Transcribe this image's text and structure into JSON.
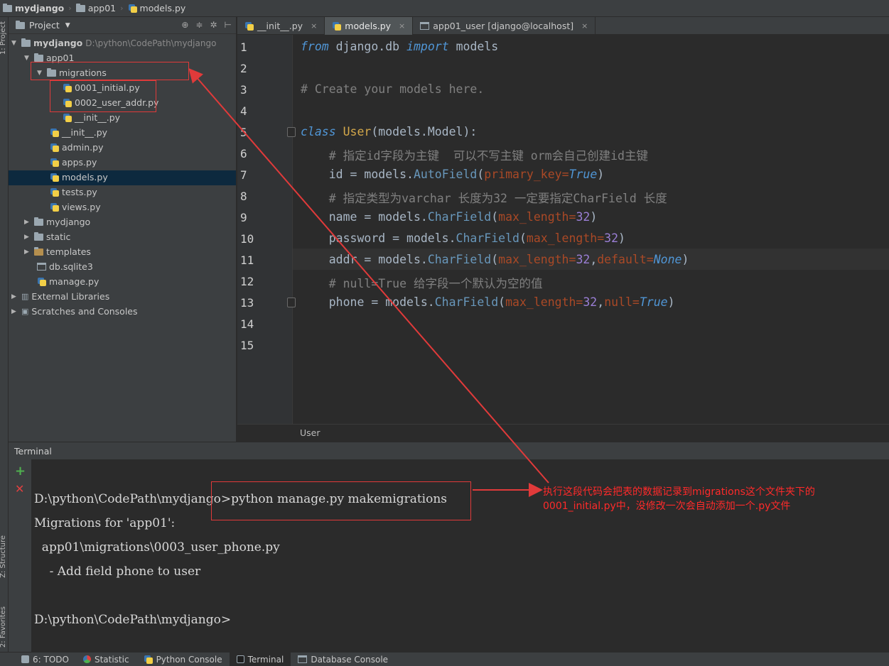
{
  "breadcrumb": [
    "mydjango",
    "app01",
    "models.py"
  ],
  "left_strip": {
    "project_tab": "1: Project",
    "structure_tab": "Z: Structure",
    "favorites_tab": "2: Favorites"
  },
  "project": {
    "header": "Project",
    "root_name": "mydjango",
    "root_path": "D:\\python\\CodePath\\mydjango",
    "items": {
      "app01": "app01",
      "migrations": "migrations",
      "m1": "0001_initial.py",
      "m2": "0002_user_addr.py",
      "m_init": "__init__.py",
      "init": "__init__.py",
      "admin": "admin.py",
      "apps": "apps.py",
      "models": "models.py",
      "tests": "tests.py",
      "views": "views.py",
      "mydjango": "mydjango",
      "static": "static",
      "templates": "templates",
      "db": "db.sqlite3",
      "manage": "manage.py",
      "ext": "External Libraries",
      "scratch": "Scratches and Consoles"
    }
  },
  "tabs": [
    {
      "label": "__init__.py"
    },
    {
      "label": "models.py"
    },
    {
      "label": "app01_user [django@localhost]"
    }
  ],
  "editor": {
    "line_numbers": [
      "1",
      "2",
      "3",
      "4",
      "5",
      "6",
      "7",
      "8",
      "9",
      "10",
      "11",
      "12",
      "13",
      "14",
      "15"
    ],
    "line1": {
      "from": "from",
      "mod": " django.db ",
      "import": "import",
      "rest": " models"
    },
    "line3": "# Create your models here.",
    "line5": {
      "class": "class",
      "name": " User",
      "rest": "(models.Model):"
    },
    "line6": "    # 指定id字段为主键  可以不写主键 orm会自己创建id主键",
    "line7": {
      "a": "    id = models.",
      "fn": "AutoField",
      "b": "(",
      "p": "primary_key=",
      "v": "True",
      "c": ")"
    },
    "line8": "    # 指定类型为varchar 长度为32 一定要指定CharField 长度",
    "line9": {
      "a": "    name = models.",
      "fn": "CharField",
      "b": "(",
      "p": "max_length=",
      "n": "32",
      "c": ")"
    },
    "line10": {
      "a": "    password = models.",
      "fn": "CharField",
      "b": "(",
      "p": "max_length=",
      "n": "32",
      "c": ")"
    },
    "line11": {
      "a": "    addr = models.",
      "fn": "CharField",
      "b": "(",
      "p": "max_length=",
      "n": "32",
      "d": ",",
      "p2": "default=",
      "v": "None",
      "c": ")"
    },
    "line12": "    # null=True 给字段一个默认为空的值",
    "line13": {
      "a": "    phone = models.",
      "fn": "CharField",
      "b": "(",
      "p": "max_length=",
      "n": "32",
      "d": ",",
      "p2": "null=",
      "v": "True",
      "c": ")"
    },
    "breadcrumb_bottom": "User"
  },
  "terminal": {
    "title": "Terminal",
    "lines": [
      "D:\\python\\CodePath\\mydjango>python manage.py makemigrations",
      "Migrations for 'app01':",
      "  app01\\migrations\\0003_user_phone.py",
      "    - Add field phone to user",
      "",
      "D:\\python\\CodePath\\mydjango>"
    ]
  },
  "annotation": {
    "line1": "执行这段代码会把表的数据记录到migrations这个文件夹下的",
    "line2": "0001_initial.py中，没修改一次会自动添加一个.py文件"
  },
  "bottom_tabs": [
    {
      "label": "6: TODO",
      "icon": "todo-icon"
    },
    {
      "label": "Statistic",
      "icon": "statistic-icon"
    },
    {
      "label": "Python Console",
      "icon": "python-icon"
    },
    {
      "label": "Terminal",
      "icon": "terminal-icon"
    },
    {
      "label": "Database Console",
      "icon": "database-icon"
    }
  ],
  "colors": {
    "annotation_red": "#e03a3a",
    "keyword": "#5096d6",
    "comment": "#808080",
    "class_name": "#d4a84a",
    "number": "#9b7fd6",
    "param": "#aa4926"
  }
}
